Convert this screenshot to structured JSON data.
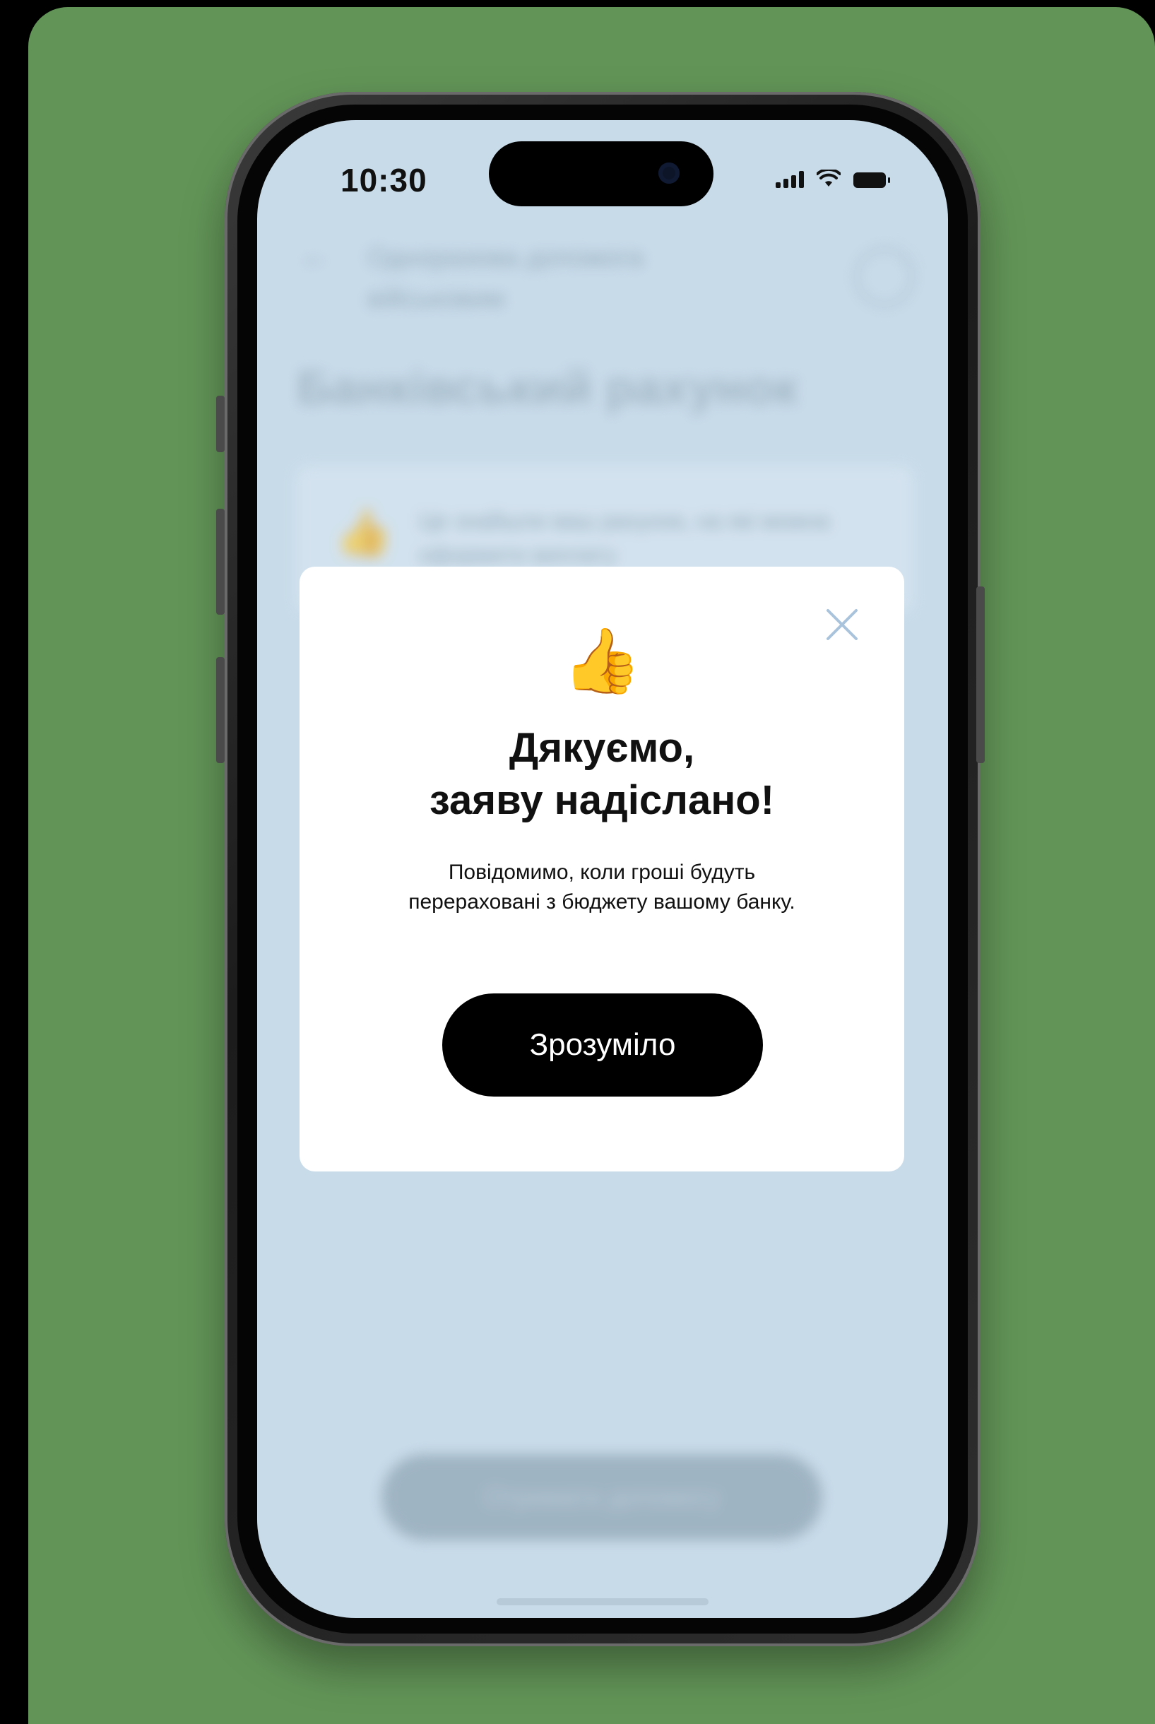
{
  "status_bar": {
    "time": "10:30",
    "icons": [
      "signal-icon",
      "wifi-icon",
      "battery-icon"
    ]
  },
  "background_screen": {
    "back_icon": "arrow-left-icon",
    "header": "Одноразова допомога військовим",
    "info_icon": "info-icon",
    "title": "Банківський рахунок",
    "info_card_text": "Це знайшли ваш рахунок, на які можна оформити виплату",
    "bottom_button": "Отримати допомогу"
  },
  "modal": {
    "emoji": "👍",
    "title_line1": "Дякуємо,",
    "title_line2": "заяву надіслано!",
    "description": "Повідомимо, коли гроші будуть перераховані з бюджету вашому банку.",
    "confirm_button": "Зрозуміло",
    "close_icon": "close-icon"
  },
  "colors": {
    "background_green": "#629457",
    "screen_blue": "#c8dbe9",
    "close_icon_blue": "#a9c3dc",
    "button_black": "#000000",
    "modal_white": "#ffffff"
  }
}
